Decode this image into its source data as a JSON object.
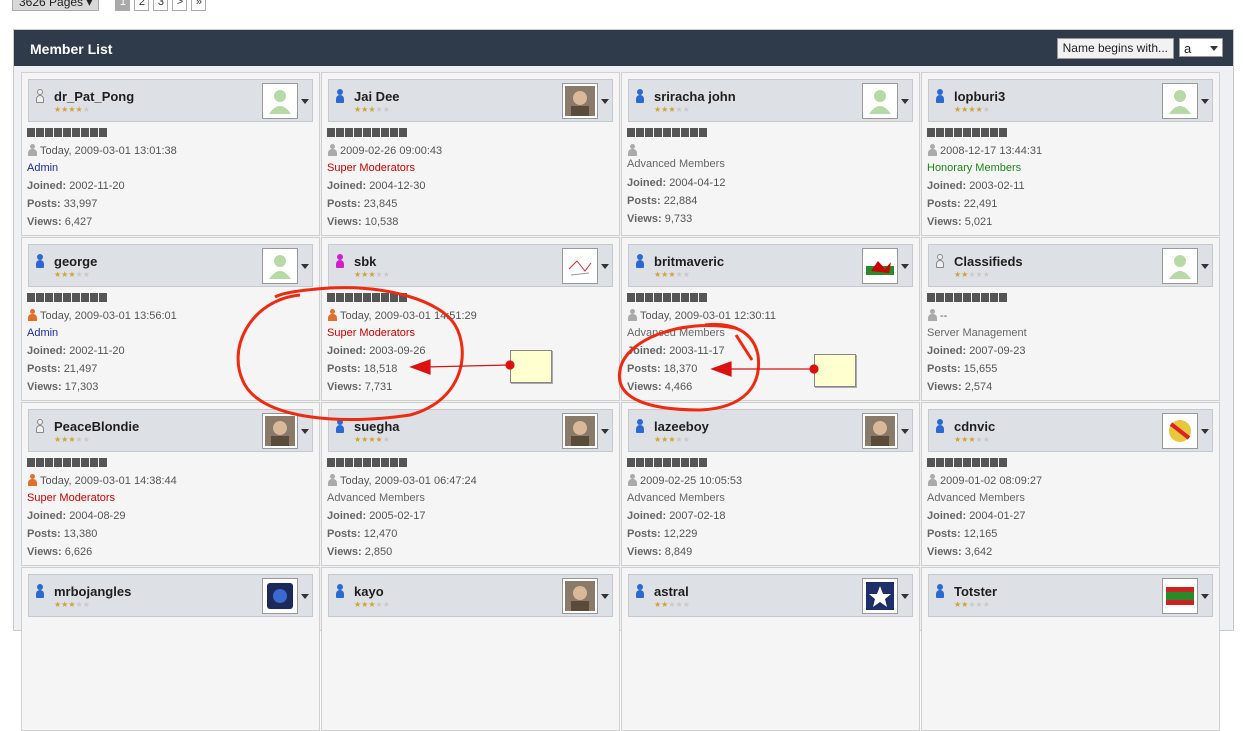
{
  "pagination": {
    "pages_label": "3626 Pages",
    "pages": [
      "1",
      "2",
      "3"
    ],
    "current": "1",
    "next": ">",
    "last": "»"
  },
  "header": {
    "title": "Member List",
    "filter_button": "Name begins with...",
    "filter_value": "a"
  },
  "members": [
    {
      "name": "dr_Pat_Pong",
      "last": "Today, 2009-03-01 13:01:38",
      "group": "Admin",
      "joined": "2002-11-20",
      "posts": "33,997",
      "views": "6,427",
      "stars": 4
    },
    {
      "name": "Jai Dee",
      "last": "2009-02-26 09:00:43",
      "group": "Super Moderators",
      "joined": "2004-12-30",
      "posts": "23,845",
      "views": "10,538",
      "stars": 3
    },
    {
      "name": "sriracha john",
      "last": "",
      "group": "Advanced Members",
      "joined": "2004-04-12",
      "posts": "22,884",
      "views": "9,733",
      "stars": 3
    },
    {
      "name": "lopburi3",
      "last": "2008-12-17 13:44:31",
      "group": "Honorary Members",
      "joined": "2003-02-11",
      "posts": "22,491",
      "views": "5,021",
      "stars": 4
    },
    {
      "name": "george",
      "last": "Today, 2009-03-01 13:56:01",
      "group": "Admin",
      "joined": "2002-11-20",
      "posts": "21,497",
      "views": "17,303",
      "stars": 3
    },
    {
      "name": "sbk",
      "last": "Today, 2009-03-01 14:51:29",
      "group": "Super Moderators",
      "joined": "2003-09-26",
      "posts": "18,518",
      "views": "7,731",
      "stars": 3
    },
    {
      "name": "britmaveric",
      "last": "Today, 2009-03-01 12:30:11",
      "group": "Advanced Members",
      "joined": "2003-11-17",
      "posts": "18,370",
      "views": "4,466",
      "stars": 3
    },
    {
      "name": "Classifieds",
      "last": "--",
      "group": "Server Management",
      "joined": "2007-09-23",
      "posts": "15,655",
      "views": "2,574",
      "stars": 2
    },
    {
      "name": "PeaceBlondie",
      "last": "Today, 2009-03-01 14:38:44",
      "group": "Super Moderators",
      "joined": "2004-08-29",
      "posts": "13,380",
      "views": "6,626",
      "stars": 3
    },
    {
      "name": "suegha",
      "last": "Today, 2009-03-01 06:47:24",
      "group": "Advanced Members",
      "joined": "2005-02-17",
      "posts": "12,470",
      "views": "2,850",
      "stars": 4
    },
    {
      "name": "lazeeboy",
      "last": "2009-02-25 10:05:53",
      "group": "Advanced Members",
      "joined": "2007-02-18",
      "posts": "12,229",
      "views": "8,849",
      "stars": 3
    },
    {
      "name": "cdnvic",
      "last": "2009-01-02 08:09:27",
      "group": "Advanced Members",
      "joined": "2004-01-27",
      "posts": "12,165",
      "views": "3,642",
      "stars": 3
    },
    {
      "name": "mrbojangles",
      "last": "",
      "group": "",
      "joined": "",
      "posts": "",
      "views": "",
      "stars": 3
    },
    {
      "name": "kayo",
      "last": "",
      "group": "",
      "joined": "",
      "posts": "",
      "views": "",
      "stars": 3
    },
    {
      "name": "astral",
      "last": "",
      "group": "",
      "joined": "",
      "posts": "",
      "views": "",
      "stars": 2
    },
    {
      "name": "Totster",
      "last": "",
      "group": "",
      "joined": "",
      "posts": "",
      "views": "",
      "stars": 2
    }
  ],
  "labels": {
    "joined": "Joined:",
    "posts": "Posts:",
    "views": "Views:"
  }
}
